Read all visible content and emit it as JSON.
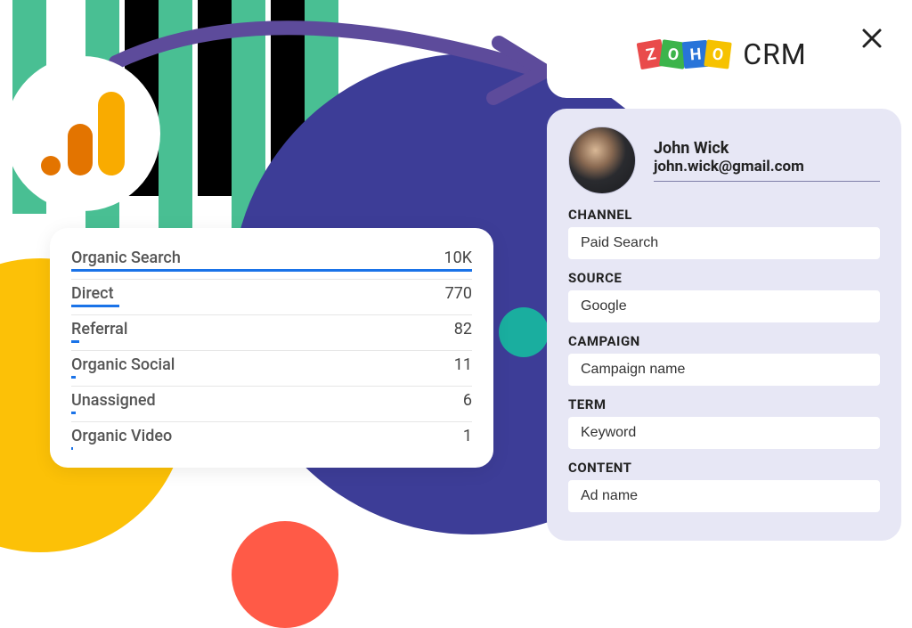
{
  "analytics": {
    "rows": [
      {
        "label": "Organic Search",
        "value": "10K",
        "pct": 100
      },
      {
        "label": "Direct",
        "value": "770",
        "pct": 12
      },
      {
        "label": "Referral",
        "value": "82",
        "pct": 2
      },
      {
        "label": "Organic Social",
        "value": "11",
        "pct": 1
      },
      {
        "label": "Unassigned",
        "value": "6",
        "pct": 1
      },
      {
        "label": "Organic Video",
        "value": "1",
        "pct": 0.5
      }
    ]
  },
  "crm": {
    "brand_crm": "CRM",
    "lead": {
      "name": "John Wick",
      "email": "john.wick@gmail.com"
    },
    "fields": [
      {
        "label": "CHANNEL",
        "value": "Paid Search"
      },
      {
        "label": "SOURCE",
        "value": "Google"
      },
      {
        "label": "CAMPAIGN",
        "value": "Campaign name"
      },
      {
        "label": "TERM",
        "value": "Keyword"
      },
      {
        "label": "CONTENT",
        "value": "Ad name"
      }
    ]
  }
}
